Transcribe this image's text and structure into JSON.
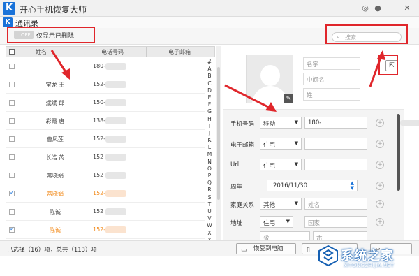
{
  "app": {
    "title": "开心手机恢复大师",
    "logo_letter": "K",
    "controls": [
      "wechat-icon",
      "chat-icon",
      "minimize-icon",
      "close-icon"
    ]
  },
  "section": {
    "logo_letter": "K",
    "title": "通讯录"
  },
  "toolbar": {
    "toggle_state": "OFF",
    "toggle_label": "仅显示已删除",
    "search_placeholder": "搜索"
  },
  "list": {
    "columns": [
      "姓名",
      "电话号码",
      "电子邮箱"
    ],
    "rows": [
      {
        "name": "",
        "phone": "180-",
        "checked": false,
        "selected": false
      },
      {
        "name": "宝龙 王",
        "phone": "152-",
        "checked": false,
        "selected": false
      },
      {
        "name": "斌斌 邱",
        "phone": "150-",
        "checked": false,
        "selected": false
      },
      {
        "name": "彩霞 唐",
        "phone": "138-",
        "checked": false,
        "selected": false
      },
      {
        "name": "曹凤莲",
        "phone": "152-",
        "checked": false,
        "selected": false
      },
      {
        "name": "长浩 芮",
        "phone": "152",
        "checked": false,
        "selected": false
      },
      {
        "name": "常晓娟",
        "phone": "152",
        "checked": false,
        "selected": false
      },
      {
        "name": "常晓娟",
        "phone": "152-",
        "checked": true,
        "selected": true
      },
      {
        "name": "陈诚",
        "phone": "152",
        "checked": false,
        "selected": false
      },
      {
        "name": "陈诚",
        "phone": "152-",
        "checked": true,
        "selected": true
      }
    ],
    "alphabet": [
      "#",
      "A",
      "B",
      "C",
      "D",
      "E",
      "F",
      "G",
      "H",
      "I",
      "J",
      "K",
      "L",
      "M",
      "N",
      "O",
      "P",
      "Q",
      "R",
      "S",
      "T",
      "U",
      "V",
      "W",
      "X",
      "Y",
      "Z",
      "#"
    ]
  },
  "status": {
    "text": "已选择（16）项，总共（113）项",
    "recover_label": "恢复到电脑"
  },
  "detail": {
    "name_fields": [
      "名字",
      "中间名",
      "姓"
    ],
    "phone": {
      "label": "手机号码",
      "type": "移动",
      "value": "180-"
    },
    "email": {
      "label": "电子邮箱",
      "type": "住宅"
    },
    "url": {
      "label": "Url",
      "type": "住宅"
    },
    "anniversary": {
      "label": "周年",
      "value": "2016/11/30"
    },
    "family": {
      "label": "家庭关系",
      "type": "其他",
      "placeholder": "姓名"
    },
    "address": {
      "label": "地址",
      "type": "住宅",
      "placeholders": [
        "国家",
        "省",
        "市"
      ]
    }
  },
  "watermark": {
    "main": "系统之家",
    "sub": "XITONGZHIJIA.NET"
  },
  "colors": {
    "highlight_red": "#e0262b",
    "brand_blue": "#1a73d9",
    "selected_orange": "#f28a1a"
  }
}
